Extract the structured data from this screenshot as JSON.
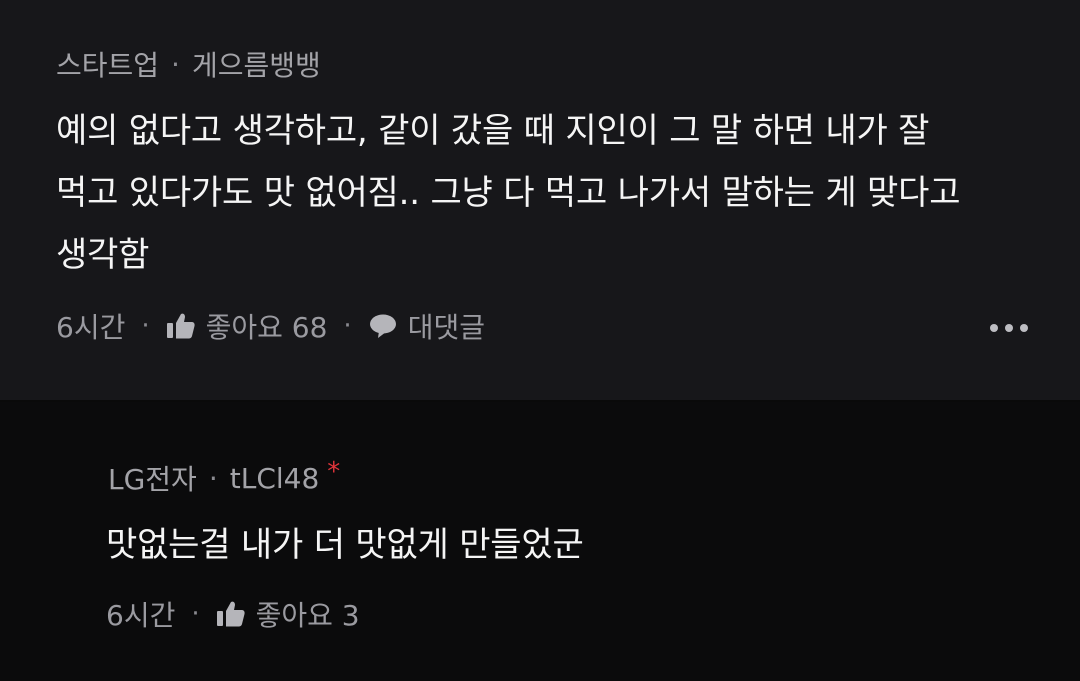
{
  "comment": {
    "category": "스타트업",
    "author": "게으름뱅뱅",
    "separator": "·",
    "line1": "예의 없다고 생각하고, 같이 갔을 때 지인이 그 말 하면 내가 잘",
    "line2": "먹고 있다가도 맛 없어짐.. 그냥 다 먹고 나가서 말하는 게 맞다고",
    "line3": "생각함",
    "time": "6시간",
    "like_label": "좋아요 68",
    "reply_label": "대댓글",
    "icons": {
      "like": "thumbs-up-icon",
      "reply": "speech-bubble-icon",
      "more": "more-horizontal-icon"
    }
  },
  "reply": {
    "category": "LG전자",
    "author": "tLCl48",
    "separator": "·",
    "star": "*",
    "text": "맛없는걸 내가 더 맛없게 만들었군",
    "time": "6시간",
    "like_label": "좋아요 3"
  },
  "colors": {
    "background": "#0b0b0c",
    "comment_bg": "#17171a",
    "text_primary": "#f5f5f5",
    "text_secondary": "#9a9aa0",
    "accent_red": "#e0343a"
  }
}
